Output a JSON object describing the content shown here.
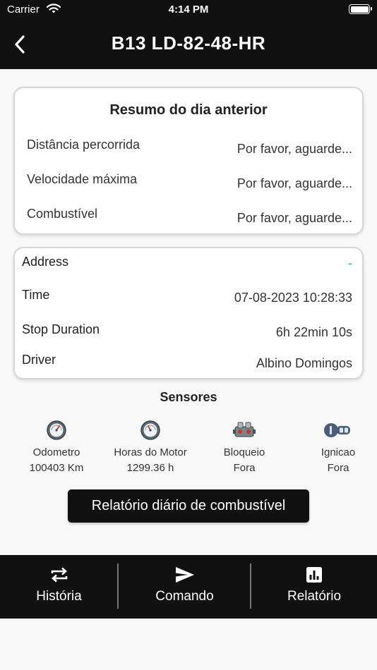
{
  "status_bar": {
    "carrier": "Carrier",
    "time": "4:14 PM"
  },
  "nav": {
    "title": "B13  LD-82-48-HR"
  },
  "summary": {
    "heading": "Resumo do dia anterior",
    "rows": [
      {
        "label": "Distância percorrida",
        "value": "Por favor, aguarde..."
      },
      {
        "label": "Velocidade máxima",
        "value": "Por favor, aguarde..."
      },
      {
        "label": "Combustível",
        "value": "Por favor, aguarde..."
      }
    ]
  },
  "details": {
    "rows": [
      {
        "label": "Address",
        "value": "-"
      },
      {
        "label": "Time",
        "value": "07-08-2023 10:28:33"
      },
      {
        "label": "Stop Duration",
        "value": "6h 22min 10s"
      },
      {
        "label": "Driver",
        "value": "Albino Domingos"
      }
    ]
  },
  "sensors": {
    "title": "Sensores",
    "items": [
      {
        "icon": "gauge-icon",
        "name": "Odometro",
        "value": "100403 Km"
      },
      {
        "icon": "gauge-icon",
        "name": "Horas do Motor",
        "value": "1299.36 h"
      },
      {
        "icon": "engine-icon",
        "name": "Bloqueio",
        "value": "Fora"
      },
      {
        "icon": "ignition-key-icon",
        "name": "Ignicao",
        "value": "Fora"
      }
    ]
  },
  "fuel_report_button": "Relatório diário de combustível",
  "tabs": [
    {
      "icon": "repeat-icon",
      "label": "História"
    },
    {
      "icon": "send-icon",
      "label": "Comando"
    },
    {
      "icon": "bar-chart-icon",
      "label": "Relatório"
    }
  ],
  "colors": {
    "dark": "#111111",
    "accent": "#2aa8c7",
    "background": "#f8f8f8"
  }
}
